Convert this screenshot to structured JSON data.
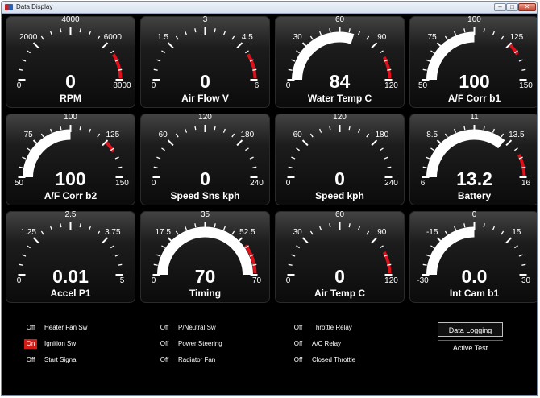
{
  "window": {
    "title": "Data Display"
  },
  "title_buttons": {
    "minimize": "–",
    "maximize": "□",
    "close": "✕"
  },
  "colors": {
    "needle": "#ffffff",
    "redline": "#e0101a",
    "on_state": "#d21c16"
  },
  "gauges": [
    {
      "label": "RPM",
      "value": "0",
      "level": 0,
      "min": 0,
      "max": 8000,
      "tick_labels": [
        "0",
        "2000",
        "4000",
        "6000",
        "8000"
      ],
      "red_from": 0.83
    },
    {
      "label": "Air Flow V",
      "value": "0",
      "level": 0,
      "min": 0,
      "max": 6,
      "tick_labels": [
        "0",
        "1.5",
        "3",
        "4.5",
        "6"
      ],
      "red_from": 0.83
    },
    {
      "label": "Water Temp C",
      "value": "84",
      "level": 0.597,
      "min": 30,
      "max": 120,
      "tick_labels": [
        "0",
        "30",
        "60",
        "90",
        "120"
      ],
      "red_from": 0.85
    },
    {
      "label": "A/F Corr b1",
      "value": "100",
      "level": 0.5,
      "min": 50,
      "max": 150,
      "tick_labels": [
        "50",
        "75",
        "100",
        "125",
        "150"
      ],
      "red_from": 0.75,
      "red_to": 0.83
    },
    {
      "label": "A/F Corr b2",
      "value": "100",
      "level": 0.5,
      "min": 50,
      "max": 150,
      "tick_labels": [
        "50",
        "75",
        "100",
        "125",
        "150"
      ],
      "red_from": 0.75,
      "red_to": 0.83
    },
    {
      "label": "Speed Sns kph",
      "value": "0",
      "level": 0,
      "min": 0,
      "max": 240,
      "tick_labels": [
        "0",
        "60",
        "120",
        "180",
        "240"
      ]
    },
    {
      "label": "Speed kph",
      "value": "0",
      "level": 0,
      "min": 0,
      "max": 240,
      "tick_labels": [
        "0",
        "60",
        "120",
        "180",
        "240"
      ]
    },
    {
      "label": "Battery",
      "value": "13.2",
      "level": 0.72,
      "min": 6,
      "max": 16,
      "tick_labels": [
        "6",
        "8.5",
        "11",
        "13.5",
        "16"
      ],
      "red_from": 0.85
    },
    {
      "label": "Accel P1",
      "value": "0.01",
      "level": 0.002,
      "min": 0,
      "max": 5,
      "tick_labels": [
        "0",
        "1.25",
        "2.5",
        "3.75",
        "5"
      ]
    },
    {
      "label": "Timing",
      "value": "70",
      "level": 1.0,
      "min": 0,
      "max": 70,
      "tick_labels": [
        "0",
        "17.5",
        "35",
        "52.5",
        "70"
      ],
      "red_from": 0.8
    },
    {
      "label": "Air Temp C",
      "value": "0",
      "level": 0,
      "min": 0,
      "max": 120,
      "tick_labels": [
        "0",
        "30",
        "60",
        "90",
        "120"
      ],
      "red_from": 0.85
    },
    {
      "label": "Int Cam b1",
      "value": "0.0",
      "level": 0.5,
      "min": -30,
      "max": 30,
      "tick_labels": [
        "-30",
        "-15",
        "0",
        "15",
        "30"
      ],
      "arc_from": 0.0
    }
  ],
  "switches": [
    {
      "state": "Off",
      "name": "Heater Fan Sw",
      "on": false
    },
    {
      "state": "On",
      "name": "Ignition Sw",
      "on": true
    },
    {
      "state": "Off",
      "name": "Start Signal",
      "on": false
    },
    {
      "state": "Off",
      "name": "P/Neutral Sw",
      "on": false
    },
    {
      "state": "Off",
      "name": "Power Steering",
      "on": false
    },
    {
      "state": "Off",
      "name": "Radiator Fan",
      "on": false
    },
    {
      "state": "Off",
      "name": "Throttle Relay",
      "on": false
    },
    {
      "state": "Off",
      "name": "A/C Relay",
      "on": false
    },
    {
      "state": "Off",
      "name": "Closed Throttle",
      "on": false
    }
  ],
  "buttons": {
    "data_logging": "Data Logging",
    "active_test": "Active Test"
  }
}
